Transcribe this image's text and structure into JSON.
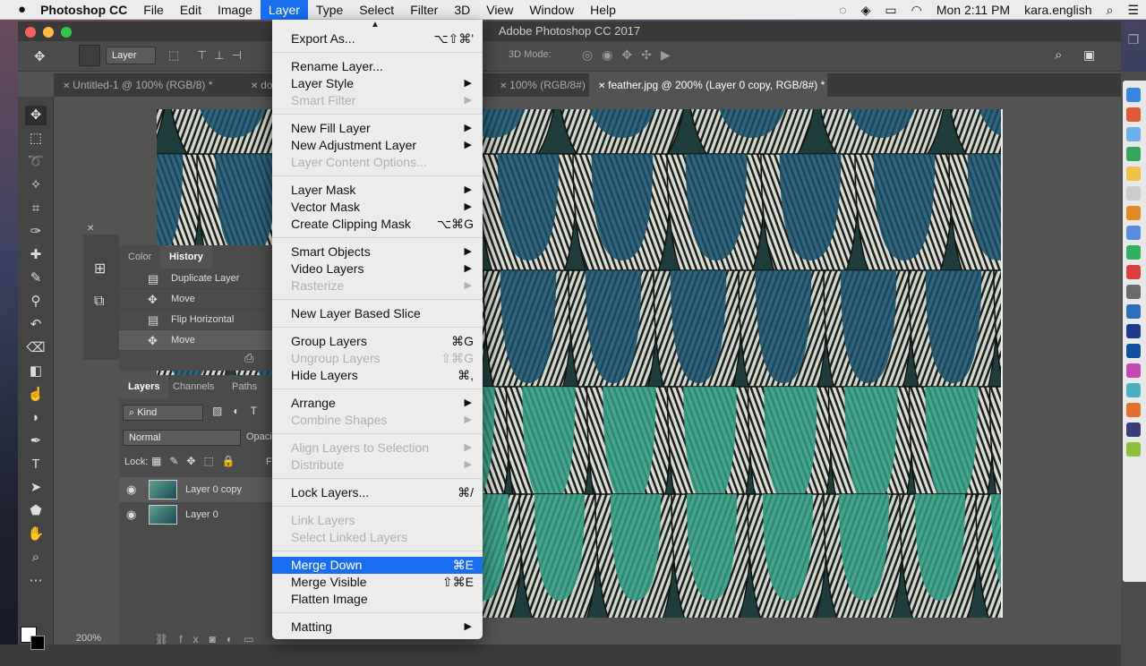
{
  "menubar": {
    "apple": "",
    "app_name": "Photoshop CC",
    "items": [
      "File",
      "Edit",
      "Image",
      "Layer",
      "Type",
      "Select",
      "Filter",
      "3D",
      "View",
      "Window",
      "Help"
    ],
    "active_index": 3,
    "clock": "Mon 2:11 PM",
    "user": "kara.english"
  },
  "window": {
    "title": "Adobe Photoshop CC 2017",
    "options": {
      "layer_select": "Layer",
      "mode_label": "3D Mode:"
    },
    "tabs": [
      {
        "label": "Untitled-1 @ 100% (RGB/8) *",
        "active": false
      },
      {
        "label": "dots",
        "active": false
      },
      {
        "label": "100% (RGB/8#)",
        "active": false
      },
      {
        "label": "feather.jpg @ 200% (Layer 0 copy, RGB/8#) *",
        "active": true
      }
    ],
    "zoom": "200%"
  },
  "history_panel": {
    "tabs": [
      "Color",
      "History"
    ],
    "active_tab": "History",
    "rows": [
      {
        "label": "Duplicate Layer",
        "icon": "layer-icon"
      },
      {
        "label": "Move",
        "icon": "move-icon"
      },
      {
        "label": "Flip Horizontal",
        "icon": "layer-icon"
      },
      {
        "label": "Move",
        "icon": "move-icon",
        "current": true
      }
    ]
  },
  "layers_panel": {
    "tabs": [
      "Layers",
      "Channels",
      "Paths"
    ],
    "active_tab": "Layers",
    "filter": "Kind",
    "blend_mode": "Normal",
    "opacity_label": "Opaci",
    "lock_label": "Lock:",
    "fill_label": "F",
    "layers": [
      {
        "name": "Layer 0 copy",
        "selected": true
      },
      {
        "name": "Layer 0",
        "selected": false
      }
    ]
  },
  "layer_menu": {
    "items": [
      {
        "label": "Export As...",
        "shortcut": "⌥⇧⌘'",
        "disabled": false,
        "submenu": false
      },
      {
        "sep": true
      },
      {
        "label": "Rename Layer...",
        "shortcut": "",
        "disabled": false,
        "submenu": false
      },
      {
        "label": "Layer Style",
        "shortcut": "",
        "disabled": false,
        "submenu": true
      },
      {
        "label": "Smart Filter",
        "shortcut": "",
        "disabled": true,
        "submenu": true
      },
      {
        "sep": true
      },
      {
        "label": "New Fill Layer",
        "shortcut": "",
        "disabled": false,
        "submenu": true
      },
      {
        "label": "New Adjustment Layer",
        "shortcut": "",
        "disabled": false,
        "submenu": true
      },
      {
        "label": "Layer Content Options...",
        "shortcut": "",
        "disabled": true,
        "submenu": false
      },
      {
        "sep": true
      },
      {
        "label": "Layer Mask",
        "shortcut": "",
        "disabled": false,
        "submenu": true
      },
      {
        "label": "Vector Mask",
        "shortcut": "",
        "disabled": false,
        "submenu": true
      },
      {
        "label": "Create Clipping Mask",
        "shortcut": "⌥⌘G",
        "disabled": false,
        "submenu": false
      },
      {
        "sep": true
      },
      {
        "label": "Smart Objects",
        "shortcut": "",
        "disabled": false,
        "submenu": true
      },
      {
        "label": "Video Layers",
        "shortcut": "",
        "disabled": false,
        "submenu": true
      },
      {
        "label": "Rasterize",
        "shortcut": "",
        "disabled": true,
        "submenu": true
      },
      {
        "sep": true
      },
      {
        "label": "New Layer Based Slice",
        "shortcut": "",
        "disabled": false,
        "submenu": false
      },
      {
        "sep": true
      },
      {
        "label": "Group Layers",
        "shortcut": "⌘G",
        "disabled": false,
        "submenu": false
      },
      {
        "label": "Ungroup Layers",
        "shortcut": "⇧⌘G",
        "disabled": true,
        "submenu": false
      },
      {
        "label": "Hide Layers",
        "shortcut": "⌘,",
        "disabled": false,
        "submenu": false
      },
      {
        "sep": true
      },
      {
        "label": "Arrange",
        "shortcut": "",
        "disabled": false,
        "submenu": true
      },
      {
        "label": "Combine Shapes",
        "shortcut": "",
        "disabled": true,
        "submenu": true
      },
      {
        "sep": true
      },
      {
        "label": "Align Layers to Selection",
        "shortcut": "",
        "disabled": true,
        "submenu": true
      },
      {
        "label": "Distribute",
        "shortcut": "",
        "disabled": true,
        "submenu": true
      },
      {
        "sep": true
      },
      {
        "label": "Lock Layers...",
        "shortcut": "⌘/",
        "disabled": false,
        "submenu": false
      },
      {
        "sep": true
      },
      {
        "label": "Link Layers",
        "shortcut": "",
        "disabled": true,
        "submenu": false
      },
      {
        "label": "Select Linked Layers",
        "shortcut": "",
        "disabled": true,
        "submenu": false
      },
      {
        "sep": true
      },
      {
        "label": "Merge Down",
        "shortcut": "⌘E",
        "disabled": false,
        "submenu": false,
        "highlighted": true
      },
      {
        "label": "Merge Visible",
        "shortcut": "⇧⌘E",
        "disabled": false,
        "submenu": false
      },
      {
        "label": "Flatten Image",
        "shortcut": "",
        "disabled": false,
        "submenu": false
      },
      {
        "sep": true
      },
      {
        "label": "Matting",
        "shortcut": "",
        "disabled": false,
        "submenu": true
      }
    ]
  },
  "tools": [
    "move-tool",
    "marquee-tool",
    "lasso-tool",
    "magic-wand-tool",
    "crop-tool",
    "eyedropper-tool",
    "healing-brush-tool",
    "brush-tool",
    "clone-stamp-tool",
    "history-brush-tool",
    "eraser-tool",
    "paint-bucket-tool",
    "smudge-tool",
    "dodge-tool",
    "pen-tool",
    "type-tool",
    "path-selection-tool",
    "shape-tool",
    "hand-tool",
    "zoom-tool",
    "more-tools"
  ],
  "colors": {
    "accent": "#1a6ff0",
    "chrome": "#535353",
    "menu_bg": "#ececec"
  }
}
